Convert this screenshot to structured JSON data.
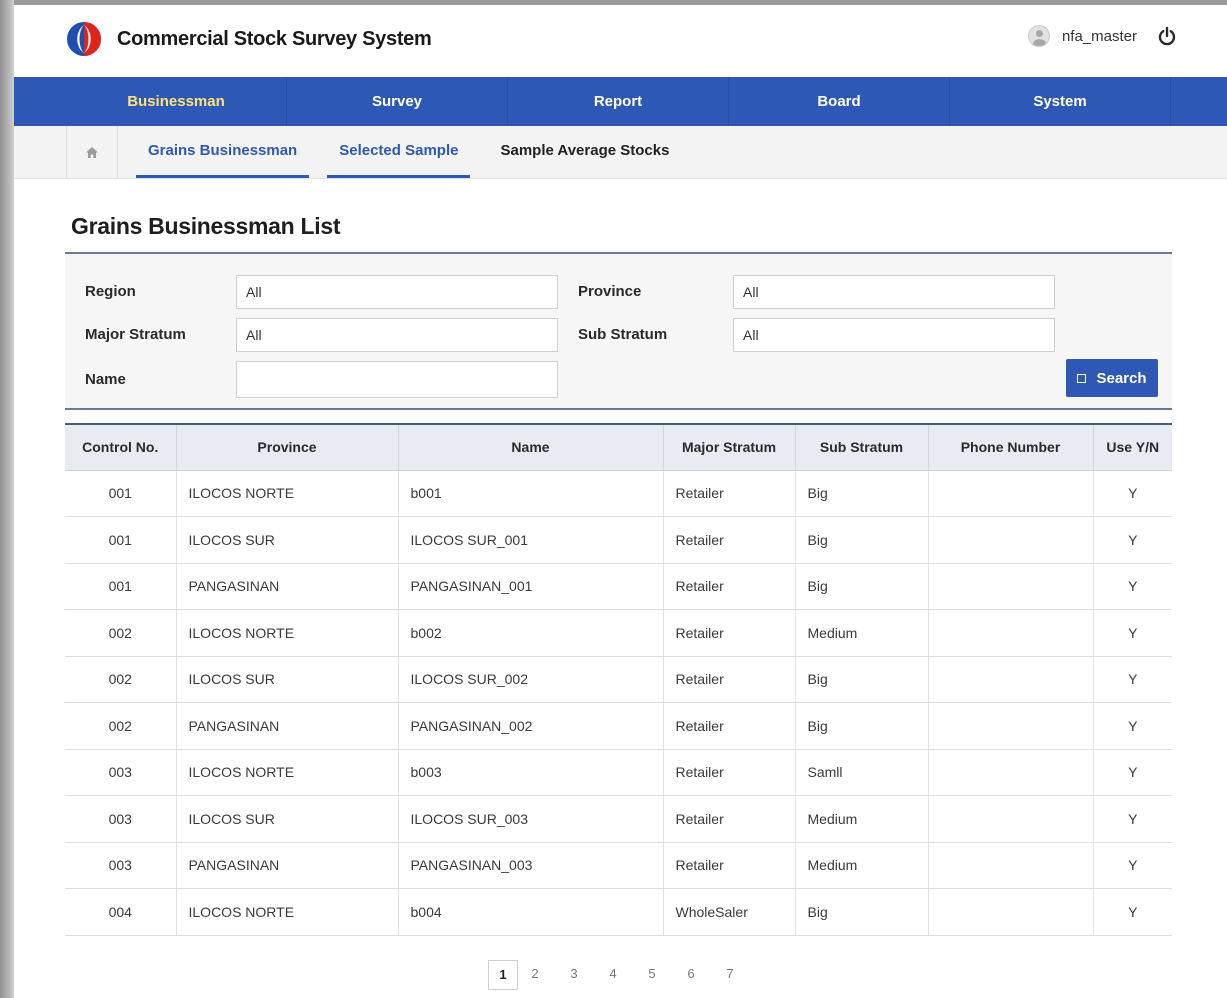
{
  "header": {
    "app_title": "Commercial Stock Survey System",
    "username": "nfa_master",
    "brand_colors": {
      "blue": "#1f4eb4",
      "red": "#e2231a",
      "accent": "#2d58b5"
    }
  },
  "mainnav": [
    {
      "label": "Businessman",
      "active": true
    },
    {
      "label": "Survey"
    },
    {
      "label": "Report"
    },
    {
      "label": "Board"
    },
    {
      "label": "System"
    }
  ],
  "subnav": {
    "home_icon": "home-icon",
    "tabs": [
      {
        "label": "Grains Businessman",
        "active": true
      },
      {
        "label": "Selected Sample",
        "active": true
      },
      {
        "label": "Sample Average Stocks"
      }
    ]
  },
  "page": {
    "title": "Grains Businessman List"
  },
  "filter": {
    "region": {
      "label": "Region",
      "value": "All"
    },
    "province": {
      "label": "Province",
      "value": "All"
    },
    "major_stratum": {
      "label": "Major Stratum",
      "value": "All"
    },
    "sub_stratum": {
      "label": "Sub Stratum",
      "value": "All"
    },
    "name": {
      "label": "Name",
      "value": ""
    },
    "search_label": "Search"
  },
  "table": {
    "columns": [
      "Control No.",
      "Province",
      "Name",
      "Major Stratum",
      "Sub Stratum",
      "Phone Number",
      "Use Y/N"
    ],
    "rows": [
      [
        "001",
        "ILOCOS NORTE",
        "b001",
        "Retailer",
        "Big",
        "",
        "Y"
      ],
      [
        "001",
        "ILOCOS SUR",
        "ILOCOS SUR_001",
        "Retailer",
        "Big",
        "",
        "Y"
      ],
      [
        "001",
        "PANGASINAN",
        "PANGASINAN_001",
        "Retailer",
        "Big",
        "",
        "Y"
      ],
      [
        "002",
        "ILOCOS NORTE",
        "b002",
        "Retailer",
        "Medium",
        "",
        "Y"
      ],
      [
        "002",
        "ILOCOS SUR",
        "ILOCOS SUR_002",
        "Retailer",
        "Big",
        "",
        "Y"
      ],
      [
        "002",
        "PANGASINAN",
        "PANGASINAN_002",
        "Retailer",
        "Big",
        "",
        "Y"
      ],
      [
        "003",
        "ILOCOS NORTE",
        "b003",
        "Retailer",
        "Samll",
        "",
        "Y"
      ],
      [
        "003",
        "ILOCOS SUR",
        "ILOCOS SUR_003",
        "Retailer",
        "Medium",
        "",
        "Y"
      ],
      [
        "003",
        "PANGASINAN",
        "PANGASINAN_003",
        "Retailer",
        "Medium",
        "",
        "Y"
      ],
      [
        "004",
        "ILOCOS NORTE",
        "b004",
        "WholeSaler",
        "Big",
        "",
        "Y"
      ]
    ]
  },
  "pagination": {
    "current": "1",
    "pages": [
      "1",
      "2",
      "3",
      "4",
      "5",
      "6",
      "7"
    ]
  }
}
